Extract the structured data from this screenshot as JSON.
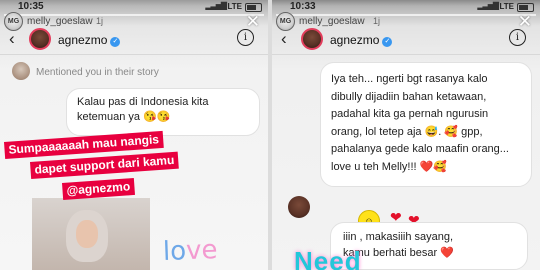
{
  "left": {
    "status": {
      "time": "10:35",
      "signal": "▂▃▅▇",
      "network": "LTE"
    },
    "story_header": {
      "avatar_text": "MG",
      "username": "melly_goeslaw",
      "age": "1j",
      "close": "✕"
    },
    "dm_header": {
      "back": "‹",
      "name": "agnezmo",
      "verified": "✓",
      "info": "i"
    },
    "mention_text": "Mentioned you in their story",
    "message": "Kalau pas di Indonesia kita ketemuan ya 😘😘",
    "sticker_lines": [
      "Sumpaaaaaah mau nangis",
      "dapet support dari kamu",
      "@agnezmo"
    ],
    "love_text": [
      "lo",
      "ve"
    ]
  },
  "right": {
    "status": {
      "time": "10:33",
      "signal": "▂▃▅▇",
      "network": "LTE"
    },
    "story_header": {
      "avatar_text": "MG",
      "username": "melly_goeslaw",
      "age": "1j",
      "close": "✕"
    },
    "dm_header": {
      "back": "‹",
      "name": "agnezmo",
      "verified": "✓",
      "info": "i"
    },
    "message": "Iya teh... ngerti bgt rasanya kalo dibully dijadiin bahan ketawaan, padahal kita ga pernah ngurusin orang, lol tetep aja 😅. 🥰 gpp, pahalanya gede kalo maafin orang... love u teh Melly!!! ❤️🥰",
    "reply_line1": "iiin , makasiiih sayang,",
    "reply_line2": "kamu berhati besar ❤️",
    "neon_text": "Need",
    "smiley": "☺",
    "heart": "❤"
  }
}
